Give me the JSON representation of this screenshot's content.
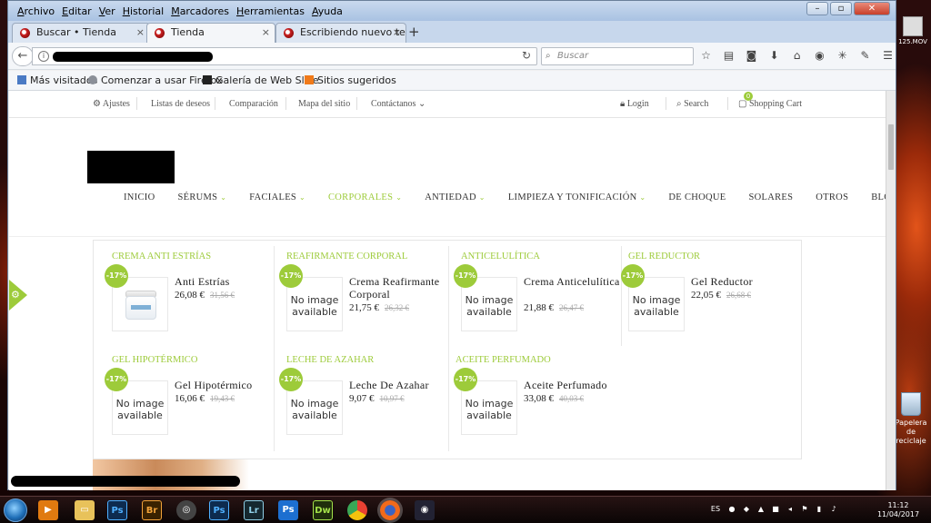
{
  "desktop": {
    "file_label": "125.MOV",
    "recycle_label": "Papelera de reciclaje"
  },
  "menubar": [
    "Archivo",
    "Editar",
    "Ver",
    "Historial",
    "Marcadores",
    "Herramientas",
    "Ayuda"
  ],
  "tabs": [
    {
      "title": "Buscar • Tienda"
    },
    {
      "title": "Tienda"
    },
    {
      "title": "Escribiendo nuevo te..."
    }
  ],
  "search": {
    "placeholder": "Buscar"
  },
  "bookmarks": [
    "Más visitados",
    "Comenzar a usar Firefox",
    "Galería de Web Slice",
    "Sitios sugeridos"
  ],
  "site": {
    "topbar": {
      "settings": "Ajustes",
      "wishlist": "Listas de deseos",
      "compare": "Comparación",
      "sitemap": "Mapa del sitio",
      "contact": "Contáctanos",
      "login": "Login",
      "search": "Search",
      "cart": "Shopping Cart",
      "cart_count": "0"
    },
    "nav": [
      "INICIO",
      "SÉRUMS",
      "FACIALES",
      "CORPORALES",
      "ANTIEDAD",
      "LIMPIEZA Y TONIFICACIÓN",
      "DE CHOQUE",
      "SOLARES",
      "OTROS",
      "BLOG"
    ],
    "mega": [
      {
        "category": "CREMA ANTI ESTRÍAS",
        "name": "Anti Estrías",
        "price": "26,08 €",
        "old": "31,56 €",
        "discount": "-17%",
        "image": "jar"
      },
      {
        "category": "REAFIRMANTE CORPORAL",
        "name": "Crema Reafirmante Corporal",
        "price": "21,75 €",
        "old": "26,32 €",
        "discount": "-17%",
        "image": "No image available"
      },
      {
        "category": "ANTICELULÍTICA",
        "name": "Crema Anticelulítica",
        "price": "21,88 €",
        "old": "26,47 €",
        "discount": "-17%",
        "image": "No image available"
      },
      {
        "category": "GEL REDUCTOR",
        "name": "Gel Reductor",
        "price": "22,05 €",
        "old": "26,68 €",
        "discount": "-17%",
        "image": "No image available"
      },
      {
        "category": "GEL HIPOTÉRMICO",
        "name": "Gel Hipotérmico",
        "price": "16,06 €",
        "old": "19,43 €",
        "discount": "-17%",
        "image": "No image available"
      },
      {
        "category": "LECHE DE AZAHAR",
        "name": "Leche De Azahar",
        "price": "9,07 €",
        "old": "10,97 €",
        "discount": "-17%",
        "image": "No image available"
      },
      {
        "category": "ACEITE PERFUMADO",
        "name": "Aceite Perfumado",
        "price": "33,08 €",
        "old": "40,03 €",
        "discount": "-17%",
        "image": "No image available"
      }
    ]
  },
  "taskbar": {
    "icons": [
      "windows-media-player",
      "file-explorer",
      "photoshop",
      "bridge",
      "capture-tool",
      "photoshop-2",
      "lightroom",
      "photoshop-3",
      "dreamweaver",
      "chrome",
      "firefox",
      "media-app"
    ],
    "lang": "ES",
    "time": "11:12",
    "date": "11/04/2017"
  },
  "colors": {
    "accent": "#9dcb3a"
  }
}
